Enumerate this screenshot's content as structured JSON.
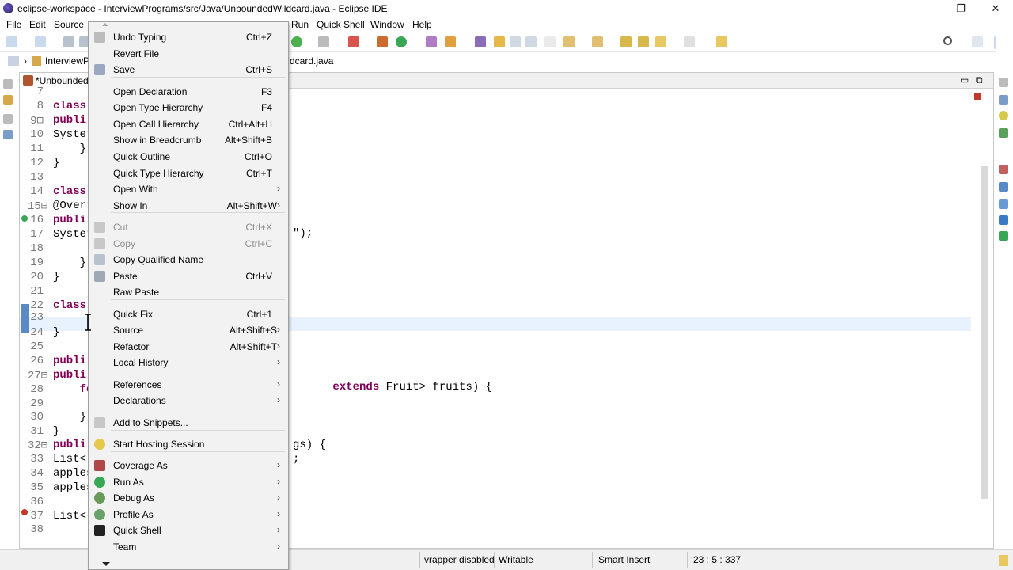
{
  "window": {
    "title": "eclipse-workspace - InterviewPrograms/src/Java/UnboundedWildcard.java - Eclipse IDE",
    "min": "—",
    "restore": "❐",
    "close": "✕"
  },
  "menubar": [
    "File",
    "Edit",
    "Source",
    "Run",
    "Window",
    "Help"
  ],
  "menubar_right": [
    "Quick Shell"
  ],
  "breadcrumb": {
    "project": "InterviewPr",
    "file": "dcard.java"
  },
  "editor": {
    "tab_label": "*UnboundedW",
    "lines": [
      {
        "n": "7",
        "text": ""
      },
      {
        "n": "8",
        "text": "class"
      },
      {
        "n": "9⊟",
        "text": "publi"
      },
      {
        "n": "10",
        "text": "Syster"
      },
      {
        "n": "11",
        "text": "    }"
      },
      {
        "n": "12",
        "text": "}"
      },
      {
        "n": "13",
        "text": ""
      },
      {
        "n": "14",
        "text": "class"
      },
      {
        "n": "15⊟",
        "text": "@Overr"
      },
      {
        "n": "16",
        "text": "publi"
      },
      {
        "n": "17",
        "text": "Syster"
      },
      {
        "n": "18",
        "text": ""
      },
      {
        "n": "19",
        "text": "    }"
      },
      {
        "n": "20",
        "text": "}"
      },
      {
        "n": "21",
        "text": ""
      },
      {
        "n": "22",
        "text": "class"
      },
      {
        "n": "23",
        "text": ""
      },
      {
        "n": "24",
        "text": "}"
      },
      {
        "n": "25",
        "text": ""
      },
      {
        "n": "26",
        "text": "publi"
      },
      {
        "n": "27⊟",
        "text": "publi"
      },
      {
        "n": "28",
        "text": "    fo"
      },
      {
        "n": "29",
        "text": ""
      },
      {
        "n": "30",
        "text": "    }"
      },
      {
        "n": "31",
        "text": "}"
      },
      {
        "n": "32⊟",
        "text": "publi"
      },
      {
        "n": "33",
        "text": "List<"
      },
      {
        "n": "34",
        "text": "apples"
      },
      {
        "n": "35",
        "text": "apples"
      },
      {
        "n": "36",
        "text": ""
      },
      {
        "n": "37",
        "text": "List<"
      },
      {
        "n": "38",
        "text": ""
      }
    ],
    "right_fragments": {
      "line17": "\");",
      "line27_kw": "extends",
      "line27_rest": " Fruit> fruits) {",
      "line32": "gs) {",
      "line33": ";"
    }
  },
  "status": {
    "wrapper": "vrapper disabled",
    "mode": "Writable",
    "insert": "Smart Insert",
    "position": "23 : 5 : 337"
  },
  "context_menu": {
    "items": [
      {
        "label": "Undo Typing",
        "shortcut": "Ctrl+Z",
        "icon": "undo-icon"
      },
      {
        "label": "Revert File",
        "shortcut": "",
        "icon": ""
      },
      {
        "label": "Save",
        "shortcut": "Ctrl+S",
        "icon": "save-icon"
      },
      {
        "label": "Open Declaration",
        "shortcut": "F3",
        "icon": ""
      },
      {
        "label": "Open Type Hierarchy",
        "shortcut": "F4",
        "icon": ""
      },
      {
        "label": "Open Call Hierarchy",
        "shortcut": "Ctrl+Alt+H",
        "icon": ""
      },
      {
        "label": "Show in Breadcrumb",
        "shortcut": "Alt+Shift+B",
        "icon": ""
      },
      {
        "label": "Quick Outline",
        "shortcut": "Ctrl+O",
        "icon": ""
      },
      {
        "label": "Quick Type Hierarchy",
        "shortcut": "Ctrl+T",
        "icon": ""
      },
      {
        "label": "Open With",
        "shortcut": "",
        "icon": "",
        "submenu": true
      },
      {
        "label": "Show In",
        "shortcut": "Alt+Shift+W",
        "icon": "",
        "submenu": true
      },
      {
        "label": "Cut",
        "shortcut": "Ctrl+X",
        "icon": "cut-icon",
        "disabled": true
      },
      {
        "label": "Copy",
        "shortcut": "Ctrl+C",
        "icon": "copy-icon",
        "disabled": true
      },
      {
        "label": "Copy Qualified Name",
        "shortcut": "",
        "icon": "copy-qualified-icon"
      },
      {
        "label": "Paste",
        "shortcut": "Ctrl+V",
        "icon": "paste-icon"
      },
      {
        "label": "Raw Paste",
        "shortcut": "",
        "icon": ""
      },
      {
        "label": "Quick Fix",
        "shortcut": "Ctrl+1",
        "icon": ""
      },
      {
        "label": "Source",
        "shortcut": "Alt+Shift+S",
        "icon": "",
        "submenu": true
      },
      {
        "label": "Refactor",
        "shortcut": "Alt+Shift+T",
        "icon": "",
        "submenu": true
      },
      {
        "label": "Local History",
        "shortcut": "",
        "icon": "",
        "submenu": true
      },
      {
        "label": "References",
        "shortcut": "",
        "icon": "",
        "submenu": true
      },
      {
        "label": "Declarations",
        "shortcut": "",
        "icon": "",
        "submenu": true
      },
      {
        "label": "Add to Snippets...",
        "shortcut": "",
        "icon": "snippet-icon"
      },
      {
        "label": "Start Hosting Session",
        "shortcut": "",
        "icon": "hosting-icon"
      },
      {
        "label": "Coverage As",
        "shortcut": "",
        "icon": "coverage-icon",
        "submenu": true
      },
      {
        "label": "Run As",
        "shortcut": "",
        "icon": "run-icon",
        "submenu": true
      },
      {
        "label": "Debug As",
        "shortcut": "",
        "icon": "debug-icon",
        "submenu": true
      },
      {
        "label": "Profile As",
        "shortcut": "",
        "icon": "profile-icon",
        "submenu": true
      },
      {
        "label": "Quick Shell",
        "shortcut": "",
        "icon": "quick-shell-icon",
        "submenu": true
      },
      {
        "label": "Team",
        "shortcut": "",
        "icon": "",
        "submenu": true
      }
    ]
  },
  "colors": {
    "keyword": "#7f0055",
    "menu_bg": "#f2f2f2",
    "current_line": "#e8f2fe",
    "line_number": "#787878"
  }
}
